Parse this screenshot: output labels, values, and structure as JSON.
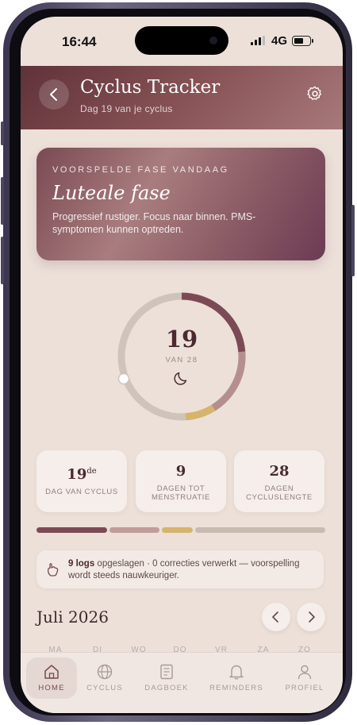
{
  "status": {
    "time": "16:44",
    "network": "4G"
  },
  "header": {
    "title": "Cyclus Tracker",
    "subtitle": "Dag 19 van je cyclus"
  },
  "phase": {
    "label": "VOORSPELDE FASE VANDAAG",
    "name": "Luteale fase",
    "description": "Progressief rustiger. Focus naar binnen. PMS-symptomen kunnen optreden."
  },
  "ring": {
    "day": "19",
    "of_label": "VAN 28",
    "progress_day": 19,
    "cycle_length": 28
  },
  "stats": [
    {
      "value": "19",
      "suffix": "de",
      "label_line1": "DAG VAN CYCLUS",
      "label_line2": ""
    },
    {
      "value": "9",
      "suffix": "",
      "label_line1": "DAGEN TOT",
      "label_line2": "MENSTRUATIE"
    },
    {
      "value": "28",
      "suffix": "",
      "label_line1": "DAGEN",
      "label_line2": "CYCLUSLENGTE"
    }
  ],
  "phase_bar_colors": [
    "#7c4a55",
    "#c19c9b",
    "#d7b46c",
    "#c7bbb2"
  ],
  "logs": {
    "count_text": "9 logs",
    "rest_text": " opgeslagen · 0 correcties verwerkt — voorspelling wordt steeds nauwkeuriger."
  },
  "calendar": {
    "month": "Juli 2026",
    "weekdays": [
      "MA",
      "DI",
      "WO",
      "DO",
      "VR",
      "ZA",
      "ZO"
    ]
  },
  "tabs": [
    {
      "label": "HOME",
      "icon": "home-icon",
      "active": true
    },
    {
      "label": "CYCLUS",
      "icon": "globe-icon",
      "active": false
    },
    {
      "label": "DAGBOEK",
      "icon": "journal-icon",
      "active": false
    },
    {
      "label": "REMINDERS",
      "icon": "bell-icon",
      "active": false
    },
    {
      "label": "PROFIEL",
      "icon": "person-icon",
      "active": false
    }
  ],
  "colors": {
    "accent": "#7a4a52",
    "background": "#ece0d9",
    "gold": "#d7b46c"
  }
}
